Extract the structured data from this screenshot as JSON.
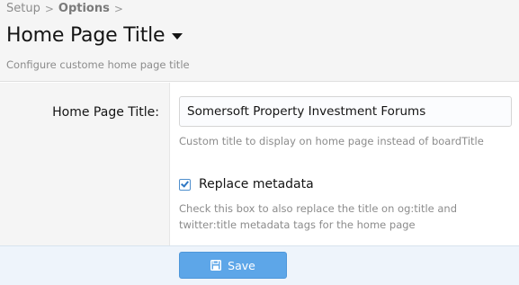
{
  "breadcrumb": {
    "items": [
      {
        "label": "Setup"
      },
      {
        "label": "Options"
      }
    ],
    "separator": ">"
  },
  "header": {
    "title": "Home Page Title",
    "description": "Configure custome home page title"
  },
  "form": {
    "home_page_title": {
      "label": "Home Page Title:",
      "value": "Somersoft Property Investment Forums",
      "hint": "Custom title to display on home page instead of boardTitle"
    },
    "replace_metadata": {
      "label": "Replace metadata",
      "checked": true,
      "hint": "Check this box to also replace the title on og:title and twitter:title metadata tags for the home page"
    }
  },
  "footer": {
    "save_label": "Save"
  },
  "icons": {
    "title_menu": "caret-down-icon",
    "save": "floppy-disk-icon",
    "checkbox": "checkmark-icon"
  },
  "colors": {
    "header_bg": "#f5f5f5",
    "footer_bg": "#eef4fb",
    "save_button_bg": "#5da6e8",
    "checkbox_accent": "#2f78c4",
    "muted_text": "#8c8c8c"
  }
}
